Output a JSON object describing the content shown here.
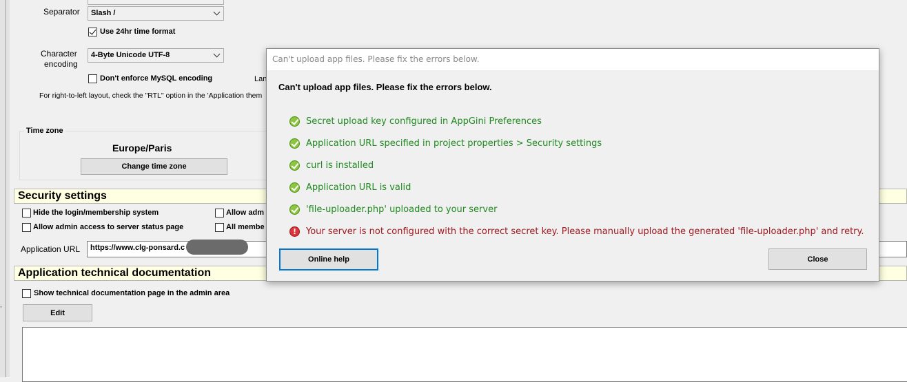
{
  "date_settings": {
    "separator_label": "Separator",
    "separator_value": "Slash /",
    "use_24hr_label": "Use 24hr time format"
  },
  "encoding": {
    "label_line1": "Character",
    "label_line2": "encoding",
    "value": "4-Byte Unicode UTF-8",
    "dont_enforce_label": "Don't enforce MySQL encoding",
    "language_label_fragment": "Lan",
    "rtl_note": "For right-to-left layout, check the \"RTL\" option in the 'Application them"
  },
  "time_zone": {
    "group_label": "Time zone",
    "value": "Europe/Paris",
    "change_button": "Change time zone"
  },
  "security": {
    "title": "Security settings",
    "hide_login": "Hide the login/membership system",
    "allow_adm_fragment": "Allow adm",
    "allow_admin_status": "Allow admin access to server status page",
    "all_members_fragment": "All membe",
    "app_url_label": "Application URL",
    "app_url_value": "https://www.clg-ponsard.c"
  },
  "tech_doc": {
    "title": "Application technical documentation",
    "show_doc_label": "Show technical documentation page in the admin area",
    "edit_button": "Edit"
  },
  "dialog": {
    "title": "Can't upload app files. Please fix the errors below.",
    "heading": "Can't upload app files. Please fix the errors below.",
    "checks": [
      {
        "status": "ok",
        "text": "Secret upload key configured in AppGini Preferences"
      },
      {
        "status": "ok",
        "text": "Application URL specified in project properties > Security settings"
      },
      {
        "status": "ok",
        "text": "curl is installed"
      },
      {
        "status": "ok",
        "text": "Application URL is valid"
      },
      {
        "status": "ok",
        "text": "'file-uploader.php' uploaded to your server"
      },
      {
        "status": "error",
        "text": "Your server is not configured with the correct secret key. Please manually upload the generated 'file-uploader.php' and retry."
      }
    ],
    "online_help_button": "Online help",
    "close_button": "Close"
  },
  "colors": {
    "ok_text": "#1f8a1f",
    "error_text": "#a0161c",
    "section_bar": "#ffffe1",
    "focus_border": "#0078d7"
  },
  "icons": {
    "ok": "check-circle-icon",
    "error": "exclamation-circle-icon"
  }
}
